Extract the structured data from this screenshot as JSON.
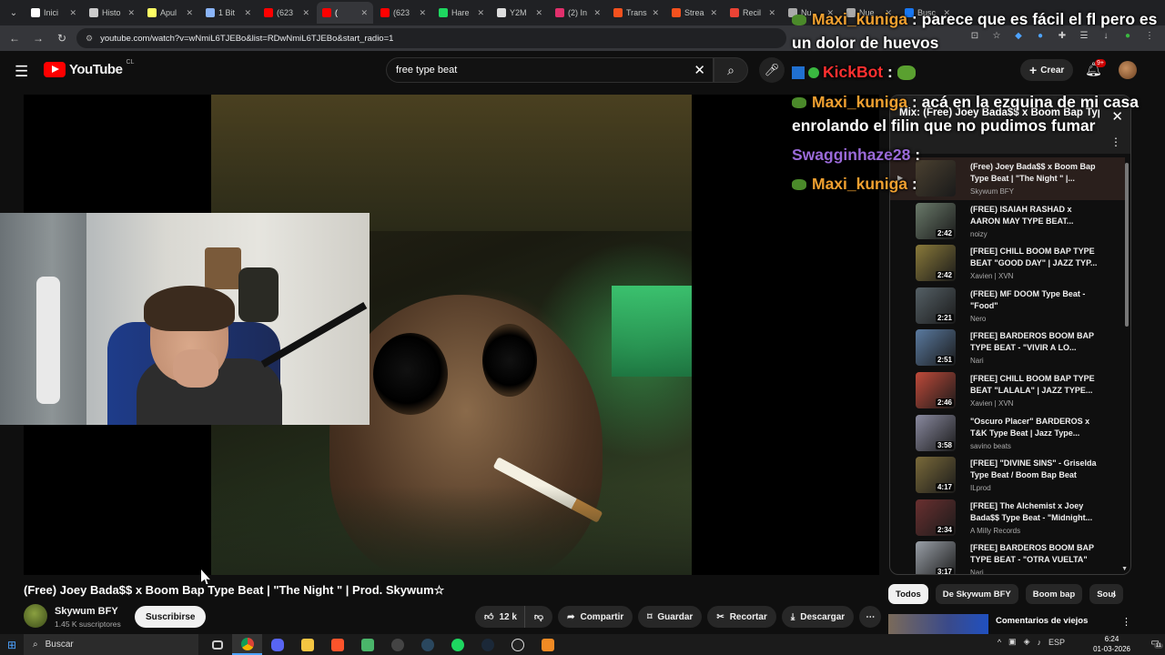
{
  "browser": {
    "tabs": [
      {
        "label": "Inici",
        "icon": "x-icon",
        "color": "#ffffff"
      },
      {
        "label": "Histo",
        "icon": "download-icon",
        "color": "#cccccc"
      },
      {
        "label": "Apul",
        "icon": "genius-icon",
        "color": "#ffff64"
      },
      {
        "label": "1 Bit",
        "icon": "globe-icon",
        "color": "#8ab4f8"
      },
      {
        "label": "(623",
        "icon": "youtube-icon",
        "color": "#ff0000"
      },
      {
        "label": "(",
        "icon": "youtube-icon",
        "color": "#ff0000",
        "active": true
      },
      {
        "label": "(623",
        "icon": "youtube-icon",
        "color": "#ff0000"
      },
      {
        "label": "Hare",
        "icon": "spotify-icon",
        "color": "#1ed760"
      },
      {
        "label": "Y2M",
        "icon": "y2mate-icon",
        "color": "#dddddd"
      },
      {
        "label": "(2) In",
        "icon": "instagram-icon",
        "color": "#e1306c"
      },
      {
        "label": "Trans",
        "icon": "translate-icon",
        "color": "#f4511e"
      },
      {
        "label": "Strea",
        "icon": "streamlabs-icon",
        "color": "#f4511e"
      },
      {
        "label": "Recil",
        "icon": "gmail-icon",
        "color": "#ea4335"
      },
      {
        "label": "Nu",
        "icon": "globe-icon",
        "color": "#aaaaaa"
      },
      {
        "label": "Nue",
        "icon": "globe-icon",
        "color": "#aaaaaa"
      },
      {
        "label": "Busc",
        "icon": "facebook-icon",
        "color": "#1877f2"
      }
    ],
    "url": "youtube.com/watch?v=wNmiL6TJEBo&list=RDwNmiL6TJEBo&start_radio=1"
  },
  "youtube": {
    "logo_text": "YouTube",
    "country": "CL",
    "search_value": "free type beat",
    "create_label": "Crear",
    "notif_count": "9+"
  },
  "video": {
    "title": "(Free) Joey Bada$$ x Boom Bap Type Beat | \"The Night \" | Prod. Skywum☆",
    "channel": "Skywum BFY",
    "subscribers": "1.45 K suscriptores",
    "subscribe_label": "Suscribirse",
    "likes": "12 k",
    "share_label": "Compartir",
    "save_label": "Guardar",
    "clip_label": "Recortar",
    "download_label": "Descargar"
  },
  "chat": [
    {
      "user": "Maxi_kuniga",
      "sep": ":",
      "message": "parece que es fácil el fl pero es",
      "color": "orange"
    },
    {
      "user": "",
      "sep": "",
      "message": "un dolor de huevos",
      "color": "orange"
    },
    {
      "user": "KickBot",
      "sep": ":",
      "message": "",
      "color": "red"
    },
    {
      "user": "Maxi_kuniga",
      "sep": ":",
      "message": "acá en la ezquina de mi casa",
      "color": "orange"
    },
    {
      "user": "",
      "sep": "",
      "message": "enrolando el filin que no pudimos fumar",
      "color": "orange"
    },
    {
      "user": "Swagginhaze28",
      "sep": ":",
      "message": "",
      "color": "purple"
    },
    {
      "user": "Maxi_kuniga",
      "sep": ":",
      "message": "",
      "color": "orange"
    }
  ],
  "playlist": {
    "title": "Mix: (Free) Joey Bada$$ x Boom Bap Type Beat | \"The Night \" | Prod. Skywum☆",
    "items": [
      {
        "title": "(Free) Joey Bada$$ x Boom Bap Type Beat | \"The Night \" |...",
        "channel": "Skywum BFY",
        "duration": "",
        "current": true,
        "thumb": "#4a4030"
      },
      {
        "title": "(FREE) ISAIAH RASHAD x AARON MAY TYPE BEAT...",
        "channel": "noizy",
        "duration": "2:42",
        "thumb": "#6a7a6a"
      },
      {
        "title": "[FREE] CHILL BOOM BAP TYPE BEAT \"GOOD DAY\" | JAZZ TYP...",
        "channel": "Xavien | XVN",
        "duration": "2:42",
        "thumb": "#8a7a3a"
      },
      {
        "title": "(FREE) MF DOOM Type Beat - \"Food\"",
        "channel": "Nero",
        "duration": "2:21",
        "thumb": "#556066"
      },
      {
        "title": "[FREE] BARDEROS BOOM BAP TYPE BEAT - \"VIVIR A LO...",
        "channel": "Nari",
        "duration": "2:51",
        "thumb": "#5a7aa0"
      },
      {
        "title": "[FREE] CHILL BOOM BAP TYPE BEAT \"LALALA\" | JAZZ TYPE...",
        "channel": "Xavien | XVN",
        "duration": "2:46",
        "thumb": "#c04a3a"
      },
      {
        "title": "\"Oscuro Placer\" BARDEROS x T&K Type Beat | Jazz Type...",
        "channel": "savino beats",
        "duration": "3:58",
        "thumb": "#8a8aa0"
      },
      {
        "title": "[FREE] \"DIVINE SINS\" - Griselda Type Beat / Boom Bap Beat",
        "channel": "ILprod",
        "duration": "4:17",
        "thumb": "#7a6a3a"
      },
      {
        "title": "[FREE] The Alchemist x Joey Bada$$ Type Beat - \"Midnight...",
        "channel": "A Milly Records",
        "duration": "2:34",
        "thumb": "#6a3030"
      },
      {
        "title": "[FREE] BARDEROS BOOM BAP TYPE BEAT - \"OTRA VUELTA\" |...",
        "channel": "Nari",
        "duration": "3:17",
        "thumb": "#9aa0a8"
      }
    ]
  },
  "chips": [
    "Todos",
    "De Skywum BFY",
    "Boom bap",
    "Soul"
  ],
  "recommendation": {
    "title": "Comentarios de viejos"
  },
  "taskbar": {
    "search_placeholder": "Buscar",
    "language": "ESP",
    "time": "6:24",
    "date": "01-03-2026",
    "notifications": "11"
  }
}
